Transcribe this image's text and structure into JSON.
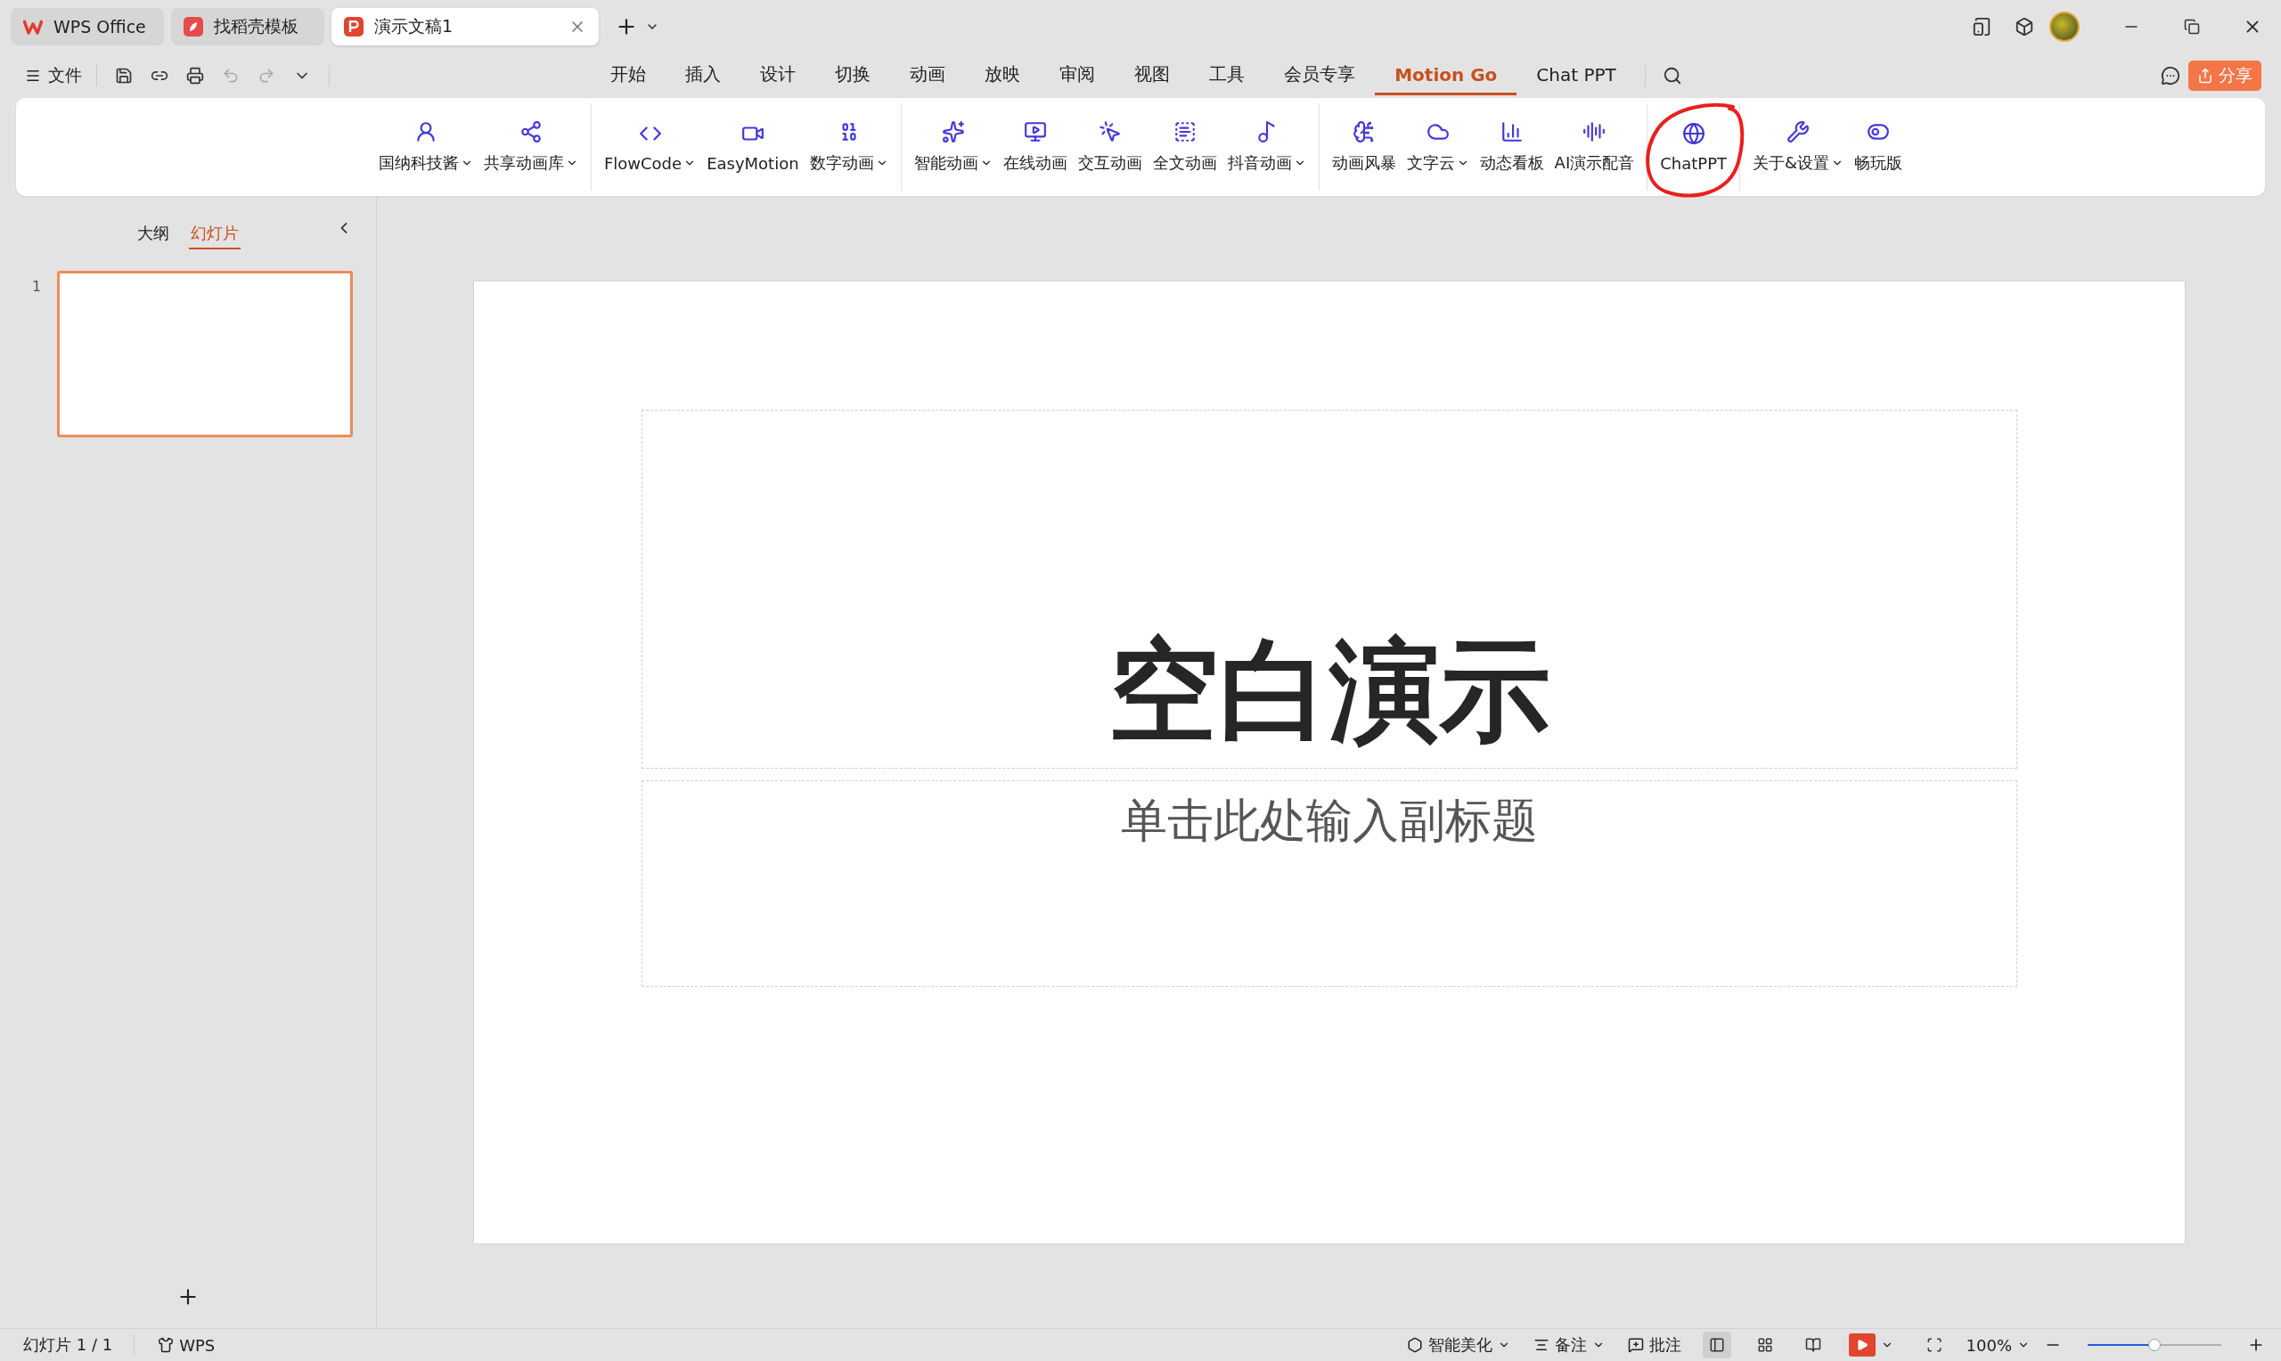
{
  "tabs": [
    {
      "label": "WPS Office",
      "kind": "wps",
      "selected": false
    },
    {
      "label": "找稻壳模板",
      "kind": "docer",
      "selected": false
    },
    {
      "label": "演示文稿1",
      "kind": "ppt",
      "selected": true
    }
  ],
  "menu": {
    "file": "文件"
  },
  "ribbon_tabs": [
    {
      "label": "开始",
      "selected": false
    },
    {
      "label": "插入",
      "selected": false
    },
    {
      "label": "设计",
      "selected": false
    },
    {
      "label": "切换",
      "selected": false
    },
    {
      "label": "动画",
      "selected": false
    },
    {
      "label": "放映",
      "selected": false
    },
    {
      "label": "审阅",
      "selected": false
    },
    {
      "label": "视图",
      "selected": false
    },
    {
      "label": "工具",
      "selected": false
    },
    {
      "label": "会员专享",
      "selected": false
    },
    {
      "label": "Motion Go",
      "selected": true
    },
    {
      "label": "Chat PPT",
      "selected": false
    }
  ],
  "share_button": "分享",
  "ribbon_groups": [
    [
      {
        "label": "国纳科技酱",
        "dropdown": true
      },
      {
        "label": "共享动画库",
        "dropdown": true
      }
    ],
    [
      {
        "label": "FlowCode",
        "dropdown": true
      },
      {
        "label": "EasyMotion",
        "dropdown": false
      },
      {
        "label": "数字动画",
        "dropdown": true
      }
    ],
    [
      {
        "label": "智能动画",
        "dropdown": true
      },
      {
        "label": "在线动画",
        "dropdown": false
      },
      {
        "label": "交互动画",
        "dropdown": false
      },
      {
        "label": "全文动画",
        "dropdown": false
      },
      {
        "label": "抖音动画",
        "dropdown": true
      }
    ],
    [
      {
        "label": "动画风暴",
        "dropdown": false
      },
      {
        "label": "文字云",
        "dropdown": true
      },
      {
        "label": "动态看板",
        "dropdown": false
      },
      {
        "label": "AI演示配音",
        "dropdown": false
      }
    ],
    [
      {
        "label": "ChatPPT",
        "dropdown": false
      }
    ],
    [
      {
        "label": "关于&设置",
        "dropdown": true
      },
      {
        "label": "畅玩版",
        "dropdown": false
      }
    ]
  ],
  "panel_tabs": [
    {
      "label": "大纲",
      "selected": false
    },
    {
      "label": "幻灯片",
      "selected": true
    }
  ],
  "slides": [
    {
      "number": "1",
      "selected": true
    }
  ],
  "slide": {
    "title": "空白演示",
    "subtitle": "单击此处输入副标题"
  },
  "status_bar": {
    "slide_count": "幻灯片 1 / 1",
    "theme": "WPS",
    "beautify": "智能美化",
    "notes": "备注",
    "comments": "批注",
    "views": [
      {
        "kind": "normal",
        "selected": true
      },
      {
        "kind": "sorter",
        "selected": false
      },
      {
        "kind": "reading",
        "selected": false
      }
    ],
    "zoom": "100%",
    "zoom_slider": {
      "level": 0.5
    }
  }
}
